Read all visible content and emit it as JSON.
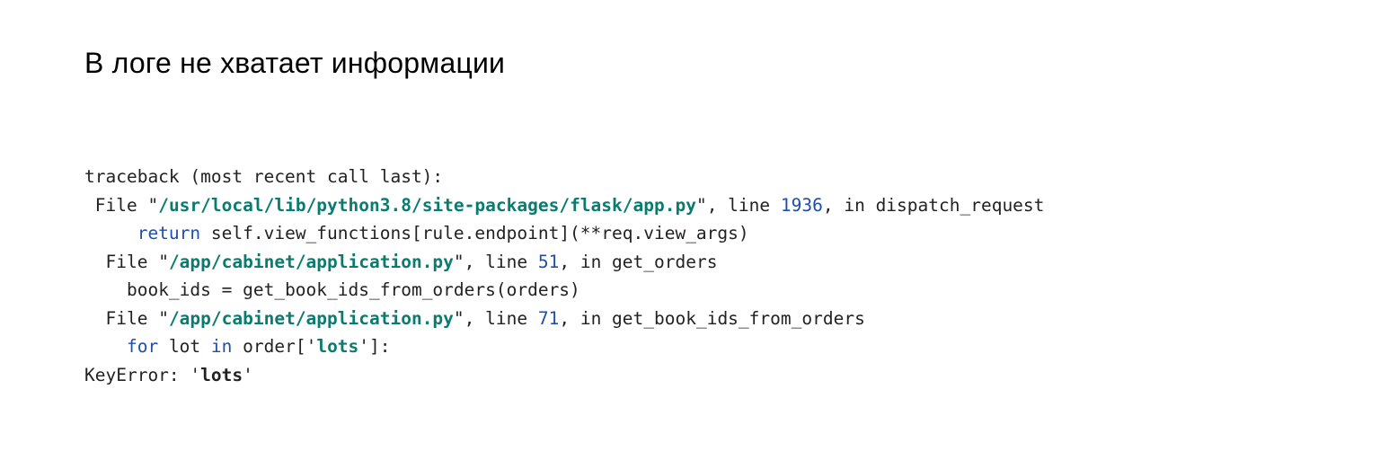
{
  "title": "В логе не хватает информации",
  "traceback": {
    "header": "traceback (most recent call last):",
    "frames": [
      {
        "file_prefix": " File ",
        "quote_open": "\"",
        "path": "/usr/local/lib/python3.8/site-packages/flask/app.py",
        "quote_close": "\"",
        "line_label": ", line ",
        "line_no": "1936",
        "in_label": ", in ",
        "func": "dispatch_request",
        "code_indent": "     ",
        "code_kw": "return",
        "code_rest": " self.view_functions[rule.endpoint](**req.view_args)"
      },
      {
        "file_prefix": "  File ",
        "quote_open": "\"",
        "path": "/app/cabinet/application.py",
        "quote_close": "\"",
        "line_label": ", line ",
        "line_no": "51",
        "in_label": ", in ",
        "func": "get_orders",
        "code_indent": "    ",
        "code_rest_full": "book_ids = get_book_ids_from_orders(orders)"
      },
      {
        "file_prefix": "  File ",
        "quote_open": "\"",
        "path": "/app/cabinet/application.py",
        "quote_close": "\"",
        "line_label": ", line ",
        "line_no": "71",
        "in_label": ", in ",
        "func": "get_book_ids_from_orders",
        "code_indent": "    ",
        "code_kw1": "for",
        "code_mid1": " lot ",
        "code_kw2": "in",
        "code_mid2": " order[",
        "code_str_open": "'",
        "code_str": "lots",
        "code_str_close": "'",
        "code_end": "]:"
      }
    ],
    "error_label": "KeyError: ",
    "error_quote_open": "'",
    "error_key": "lots",
    "error_quote_close": "'"
  }
}
